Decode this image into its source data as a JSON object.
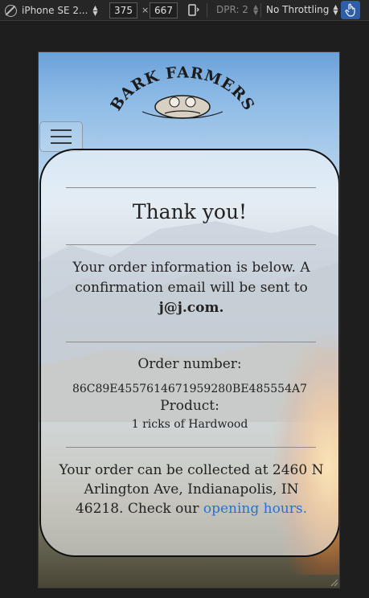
{
  "devtools": {
    "device_name": "iPhone SE 2...",
    "width": "375",
    "times": "×",
    "height": "667",
    "dpr": "DPR: 2",
    "throttling": "No Throttling"
  },
  "page": {
    "logo_text": "BARK FARMERS",
    "thank_you": "Thank you!",
    "info_text": "Your order information is below. A confirmation email will be sent to",
    "email": "j@j.com.",
    "order_number_label": "Order number:",
    "order_number": "86C89E4557614671959280BE485554A7",
    "product_label": "Product:",
    "product_value": "1 ricks of Hardwood",
    "collect_text": "Your order can be collected at 2460 N Arlington Ave, Indianapolis, IN 46218. Check our",
    "opening_hours_link": "opening hours.",
    "link_color": "#2a6fd6"
  }
}
